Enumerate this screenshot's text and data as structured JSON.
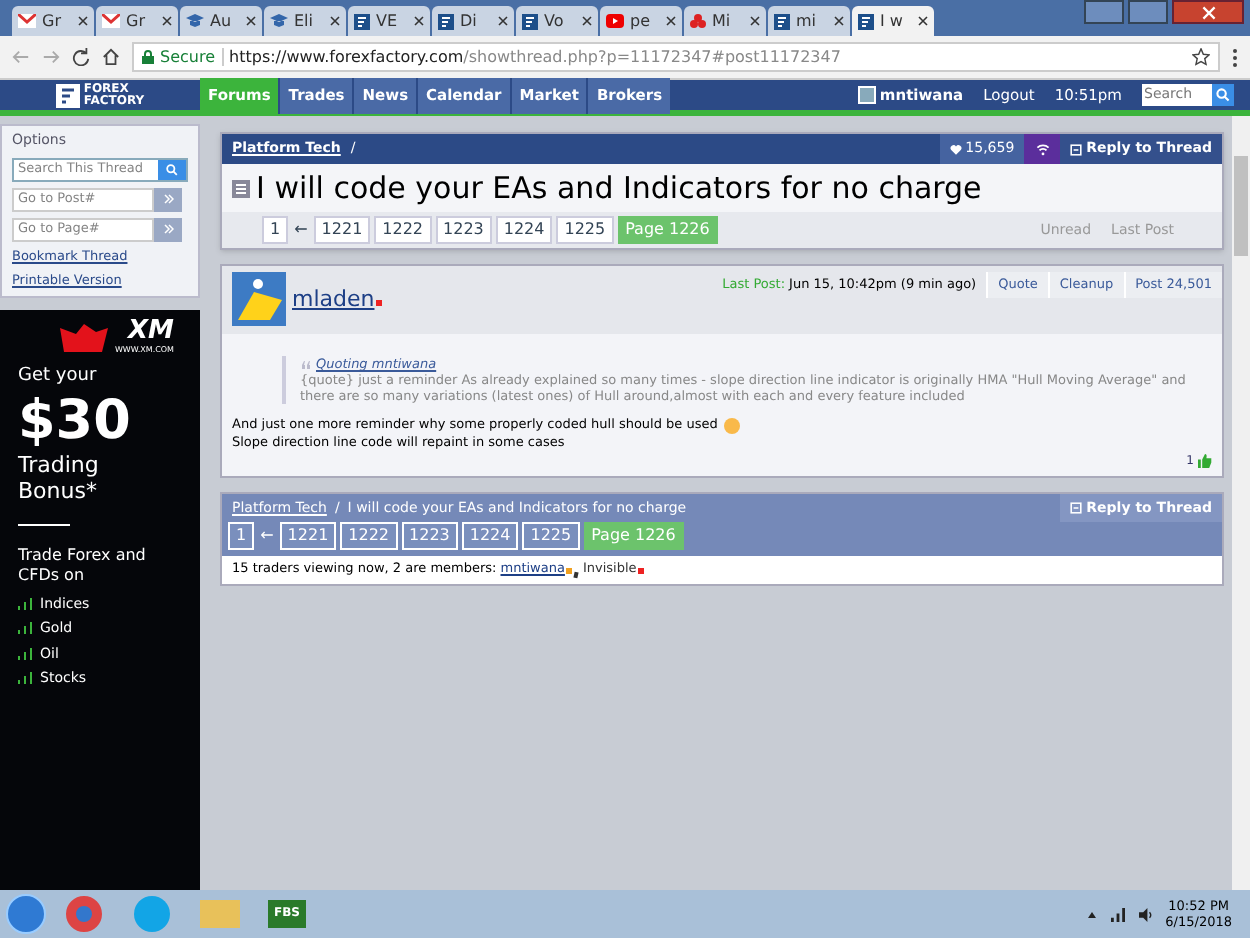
{
  "browser": {
    "tabs": [
      {
        "label": "Gr",
        "kind": "mail",
        "selected": false
      },
      {
        "label": "Gr",
        "kind": "mail",
        "selected": false
      },
      {
        "label": "Au",
        "kind": "cap",
        "selected": false
      },
      {
        "label": "Eli",
        "kind": "cap",
        "selected": false
      },
      {
        "label": "VE",
        "kind": "forum",
        "selected": false
      },
      {
        "label": "Di",
        "kind": "forum",
        "selected": false
      },
      {
        "label": "Vo",
        "kind": "forum",
        "selected": false
      },
      {
        "label": "pe",
        "kind": "video",
        "selected": false
      },
      {
        "label": "Mi",
        "kind": "flower",
        "selected": false
      },
      {
        "label": "mi",
        "kind": "forum",
        "selected": false
      },
      {
        "label": "I w",
        "kind": "forum",
        "selected": true
      }
    ],
    "secure": "Secure",
    "url_host": "https://www.forexfactory.com",
    "url_path": "/showthread.php?p=11172347#post11172347"
  },
  "site_nav": {
    "logo_line1": "FOREX",
    "logo_line2": "FACTORY",
    "items": [
      {
        "label": "Forums",
        "selected": true
      },
      {
        "label": "Trades",
        "selected": false
      },
      {
        "label": "News",
        "selected": false
      },
      {
        "label": "Calendar",
        "selected": false
      },
      {
        "label": "Market",
        "selected": false
      },
      {
        "label": "Brokers",
        "selected": false
      }
    ],
    "user": "mntiwana",
    "logout": "Logout",
    "time": "10:51pm",
    "search_placeholder": "Search"
  },
  "sidebar": {
    "title": "Options",
    "search_placeholder": "Search This Thread",
    "post_placeholder": "Go to Post#",
    "page_placeholder": "Go to Page#",
    "links": [
      "Bookmark Thread",
      "Printable Version"
    ]
  },
  "ad": {
    "headline": "Get your",
    "amount": "$30",
    "line1": "Trading",
    "line2": "Bonus*",
    "brand": "XM",
    "brand_url": "WWW.XM.COM",
    "subhead": "Trade Forex and CFDs on",
    "items": [
      "Indices",
      "Gold",
      "Oil",
      "Stocks"
    ]
  },
  "thread": {
    "breadcrumb": "Platform Tech",
    "separator": "/",
    "subscribers": "15,659",
    "reply": "Reply to Thread",
    "title": "I will code your EAs and Indicators for no charge",
    "first_page": "1",
    "arrow": "←",
    "pages": [
      {
        "label": "1221",
        "selected": false
      },
      {
        "label": "1222",
        "selected": false
      },
      {
        "label": "1223",
        "selected": false
      },
      {
        "label": "1224",
        "selected": false
      },
      {
        "label": "1225",
        "selected": false
      },
      {
        "label": "Page 1226",
        "selected": true
      }
    ],
    "unread": "Unread",
    "last_post": "Last Post"
  },
  "post": {
    "author": "mladen",
    "last_post_label": "Last Post:",
    "last_post_time": "Jun 15, 10:42pm (9 min ago)",
    "actions": [
      "Quote",
      "Cleanup",
      "Post 24,501"
    ],
    "quote_author": "Quoting mntiwana",
    "quote_text": "{quote} just a reminder As already explained so many times - slope direction line indicator is originally HMA \"Hull Moving Average\" and there are so many variations (latest ones) of Hull around,almost with each and every feature included",
    "body_line1": "And just one more reminder why some properly coded hull should be used",
    "body_line2": "Slope direction line code will repaint in some cases",
    "likes": "1"
  },
  "footer": {
    "breadcrumb": "Platform Tech",
    "separator": "/",
    "title": "I will code your EAs and Indicators for no charge",
    "reply": "Reply to Thread",
    "first_page": "1",
    "arrow": "←",
    "pages": [
      {
        "label": "1221",
        "selected": false
      },
      {
        "label": "1222",
        "selected": false
      },
      {
        "label": "1223",
        "selected": false
      },
      {
        "label": "1224",
        "selected": false
      },
      {
        "label": "1225",
        "selected": false
      },
      {
        "label": "Page 1226",
        "selected": true
      }
    ],
    "viewing": "15 traders viewing now, 2 are members:",
    "members": [
      "mntiwana",
      "Invisible"
    ]
  },
  "taskbar": {
    "fbs_label": "FBS",
    "time": "10:52 PM",
    "date": "6/15/2018"
  }
}
